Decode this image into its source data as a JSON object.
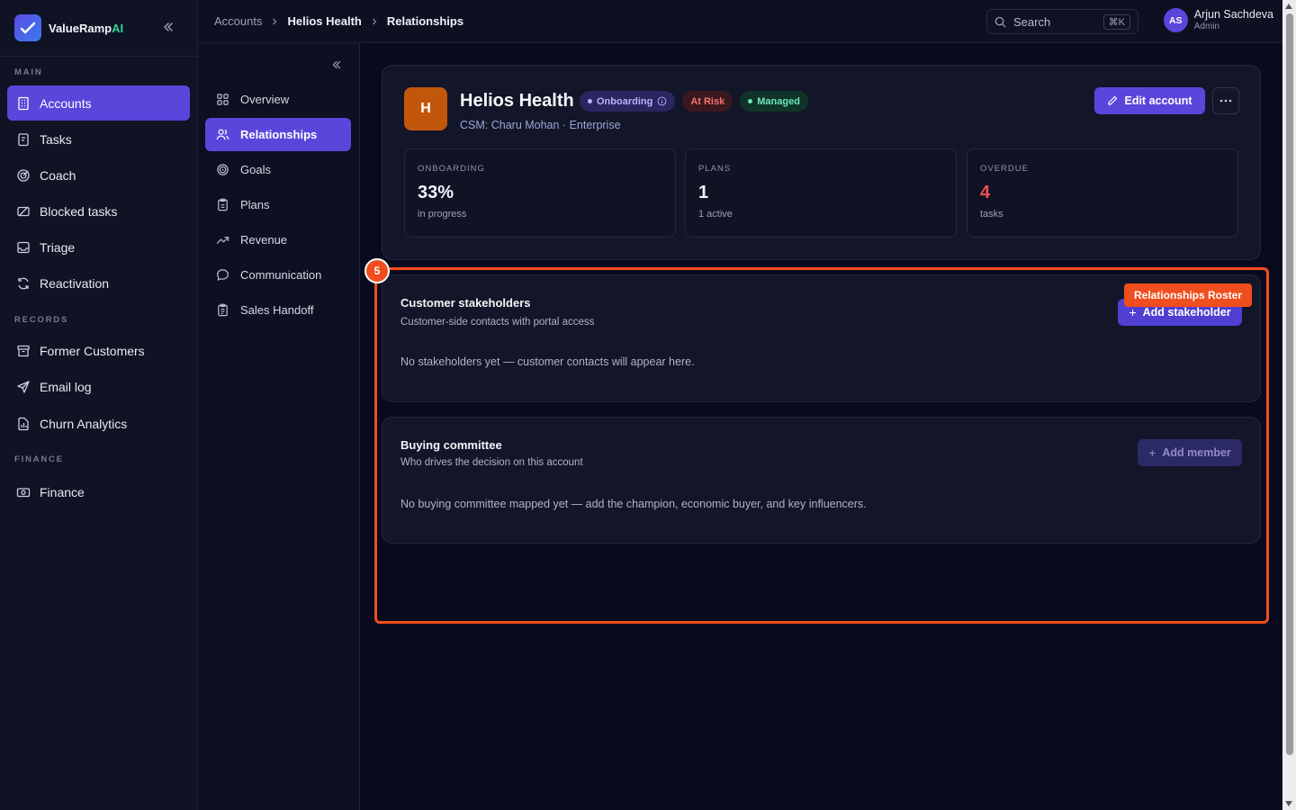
{
  "brand": {
    "name": "ValueRamp",
    "suffix": "AI"
  },
  "sidebar": {
    "sections": [
      {
        "label": "MAIN",
        "items": [
          {
            "label": "Accounts",
            "icon": "building-icon",
            "active": true
          },
          {
            "label": "Tasks",
            "icon": "clipboard-icon"
          },
          {
            "label": "Coach",
            "icon": "target-icon"
          },
          {
            "label": "Blocked tasks",
            "icon": "blocked-ticket-icon"
          },
          {
            "label": "Triage",
            "icon": "inbox-icon"
          },
          {
            "label": "Reactivation",
            "icon": "refresh-icon"
          }
        ]
      },
      {
        "label": "RECORDS",
        "items": [
          {
            "label": "Former Customers",
            "icon": "archive-icon"
          },
          {
            "label": "Email log",
            "icon": "send-icon"
          },
          {
            "label": "Churn Analytics",
            "icon": "chart-file-icon"
          }
        ]
      },
      {
        "label": "FINANCE",
        "items": [
          {
            "label": "Finance",
            "icon": "banknote-icon"
          }
        ]
      }
    ]
  },
  "breadcrumb": {
    "items": [
      "Accounts",
      "Helios Health",
      "Relationships"
    ]
  },
  "search": {
    "placeholder": "Search",
    "shortcut": "⌘K"
  },
  "user": {
    "initials": "AS",
    "name": "Arjun Sachdeva",
    "role": "Admin"
  },
  "subnav": {
    "items": [
      {
        "label": "Overview",
        "icon": "grid-icon"
      },
      {
        "label": "Relationships",
        "icon": "users-icon",
        "active": true
      },
      {
        "label": "Goals",
        "icon": "target-icon"
      },
      {
        "label": "Plans",
        "icon": "clipboard-icon"
      },
      {
        "label": "Revenue",
        "icon": "trending-up-icon"
      },
      {
        "label": "Communication",
        "icon": "chat-icon"
      },
      {
        "label": "Sales Handoff",
        "icon": "clipboard-list-icon"
      }
    ]
  },
  "account": {
    "initial": "H",
    "name": "Helios Health",
    "badges": {
      "onboarding": "Onboarding",
      "risk": "At Risk",
      "managed": "Managed"
    },
    "subtitle": "CSM: Charu Mohan · Enterprise",
    "edit_label": "Edit account",
    "stats": [
      {
        "label": "ONBOARDING",
        "value": "33%",
        "sub": "in progress"
      },
      {
        "label": "PLANS",
        "value": "1",
        "sub": "1 active"
      },
      {
        "label": "OVERDUE",
        "value": "4",
        "sub": "tasks"
      }
    ]
  },
  "stakeholders": {
    "title": "Customer stakeholders",
    "description": "Customer-side contacts with portal access",
    "button": "Add stakeholder",
    "empty": "No stakeholders yet — customer contacts will appear here."
  },
  "committee": {
    "title": "Buying committee",
    "description": "Who drives the decision on this account",
    "button": "Add member",
    "empty": "No buying committee mapped yet — add the champion, economic buyer, and key influencers."
  },
  "annotation": {
    "number": "5",
    "label": "Relationships Roster"
  },
  "colors": {
    "accent": "#5b46dc",
    "highlight": "#f04e1e",
    "danger": "#f04f4f",
    "success": "#6ee7b7"
  }
}
